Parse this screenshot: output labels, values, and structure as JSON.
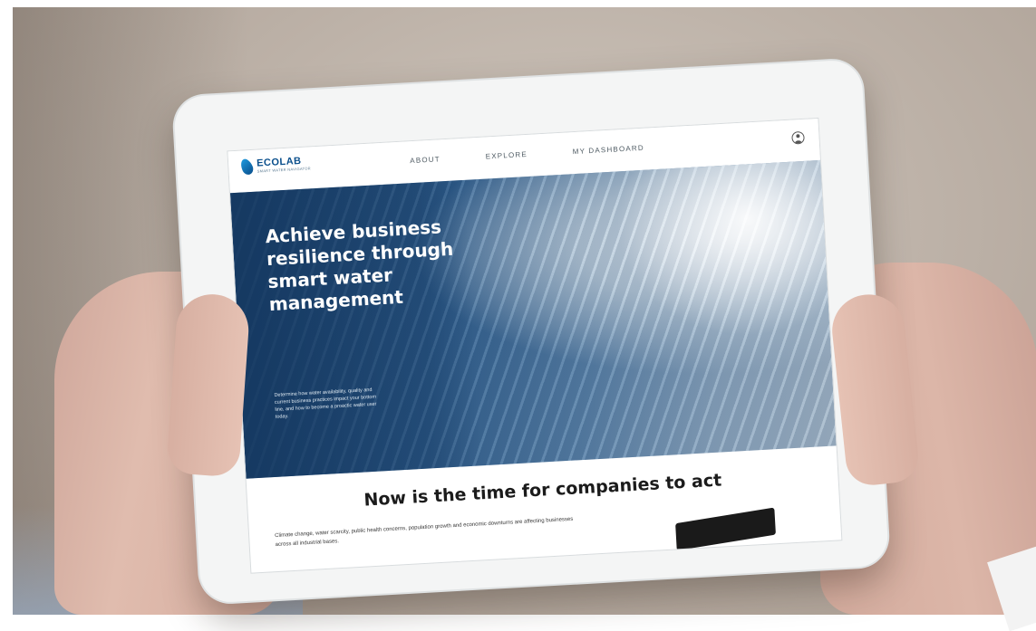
{
  "brand": {
    "logo_main": "ECOLAB",
    "logo_sub": "SMART WATER NAVIGATOR"
  },
  "nav": {
    "links": [
      "ABOUT",
      "EXPLORE",
      "MY DASHBOARD"
    ]
  },
  "hero": {
    "title": "Achieve business resilience through smart water management",
    "body": "Determine how water availability, quality and current business practices impact your bottom line, and how to become a proactic water user today."
  },
  "section": {
    "title": "Now is the time for companies to act",
    "body": "Climate change, water scarcity, public health concerns, population growth and economic downturns are affecting businesses across all industrial bases."
  },
  "icons": [
    "water-drop-logo-icon",
    "user-account-icon"
  ],
  "colors": {
    "brand_blue": "#0a4f8c",
    "hero_blue": "#1e4a78"
  }
}
